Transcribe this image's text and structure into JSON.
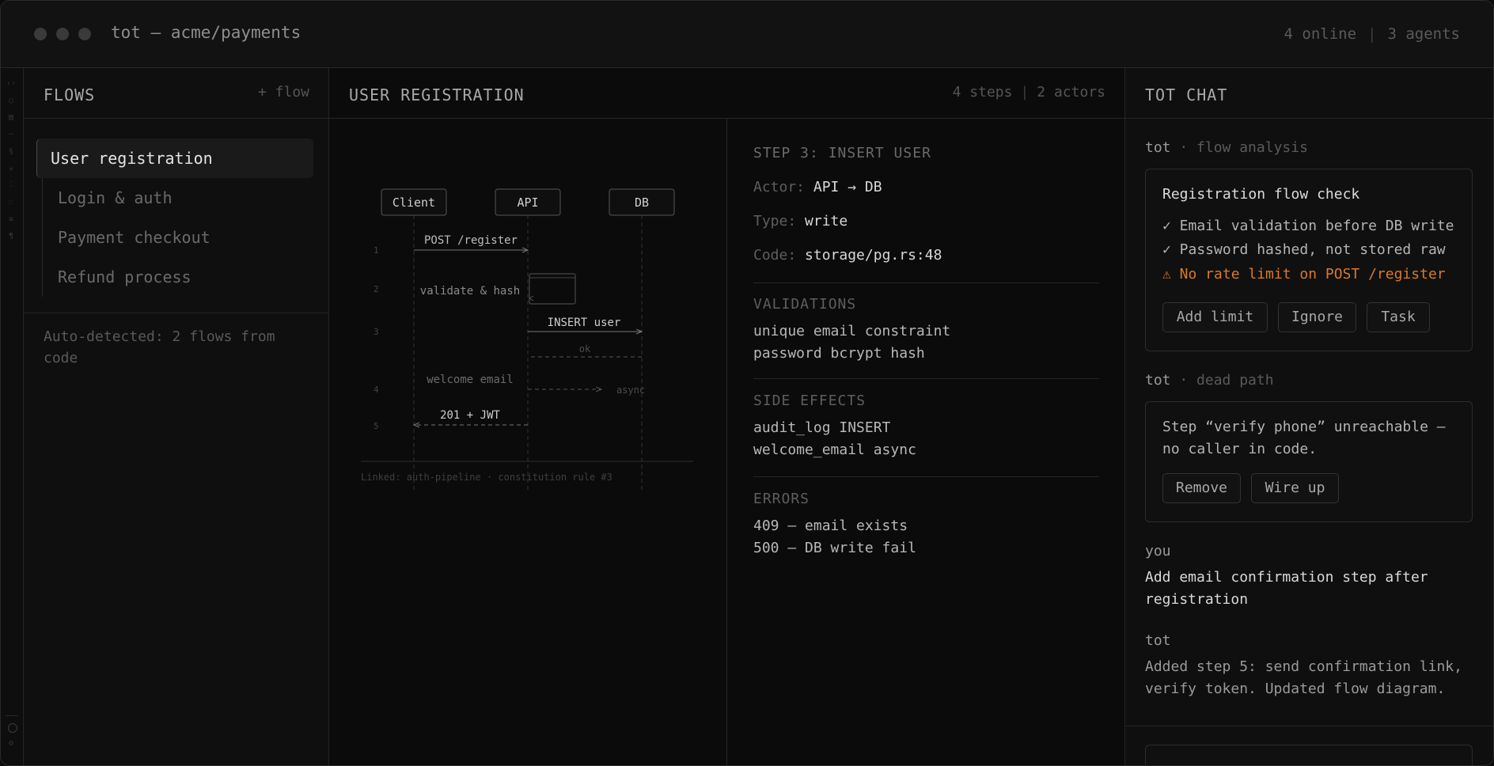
{
  "window": {
    "title": "tot — acme/payments",
    "online": "4 online",
    "agents": "3 agents"
  },
  "flows": {
    "title": "FLOWS",
    "add_label": "+ flow",
    "items": [
      {
        "label": "User registration",
        "active": true
      },
      {
        "label": "Login & auth"
      },
      {
        "label": "Payment checkout"
      },
      {
        "label": "Refund process"
      }
    ],
    "note": "Auto-detected: 2 flows from code"
  },
  "center": {
    "title": "USER REGISTRATION",
    "steps": "4 steps",
    "actors": "2 actors",
    "diagram": {
      "actors": [
        "Client",
        "API",
        "DB"
      ],
      "messages": [
        {
          "num": "1",
          "label": "POST /register"
        },
        {
          "num": "2",
          "label": "validate & hash"
        },
        {
          "num": "3",
          "label": "INSERT user",
          "reply": "ok"
        },
        {
          "num": "4",
          "label": "welcome email",
          "note": "async"
        },
        {
          "num": "5",
          "label": "201 + JWT"
        }
      ],
      "linked": "Linked: auth-pipeline · constitution rule #3"
    },
    "detail": {
      "step_title": "STEP 3: INSERT USER",
      "actor_key": "Actor:",
      "actor_val": "API → DB",
      "type_key": "Type:",
      "type_val": "write",
      "code_key": "Code:",
      "code_val": "storage/pg.rs:48",
      "validations_title": "VALIDATIONS",
      "validations": [
        "unique email constraint",
        "password bcrypt hash"
      ],
      "side_effects_title": "SIDE EFFECTS",
      "side_effects": [
        "audit_log INSERT",
        "welcome_email async"
      ],
      "errors_title": "ERRORS",
      "errors": [
        "409 — email exists",
        "500 — DB write fail"
      ]
    }
  },
  "chat": {
    "title": "TOT CHAT",
    "m1": {
      "who": "tot",
      "sub": "· flow analysis",
      "card_title": "Registration flow check",
      "checks": [
        "✓ Email validation before DB write",
        "✓ Password hashed, not stored raw",
        "⚠ No rate limit on POST /register"
      ],
      "buttons": [
        "Add limit",
        "Ignore",
        "Task"
      ]
    },
    "m2": {
      "who": "tot",
      "sub": "· dead path",
      "text": "Step “verify phone” unreachable — no caller in code.",
      "buttons": [
        "Remove",
        "Wire up"
      ]
    },
    "m3": {
      "who": "you",
      "text": "Add email confirmation step after registration"
    },
    "m4": {
      "who": "tot",
      "text": "Added step 5: send confirmation link, verify token. Updated flow diagram."
    }
  },
  "colors": {
    "background": "#0b0b0b",
    "panel": "#0f0f0f",
    "warning": "#d97a2b",
    "text_primary": "#dcdcdc",
    "text_muted": "#5a5a5a"
  }
}
